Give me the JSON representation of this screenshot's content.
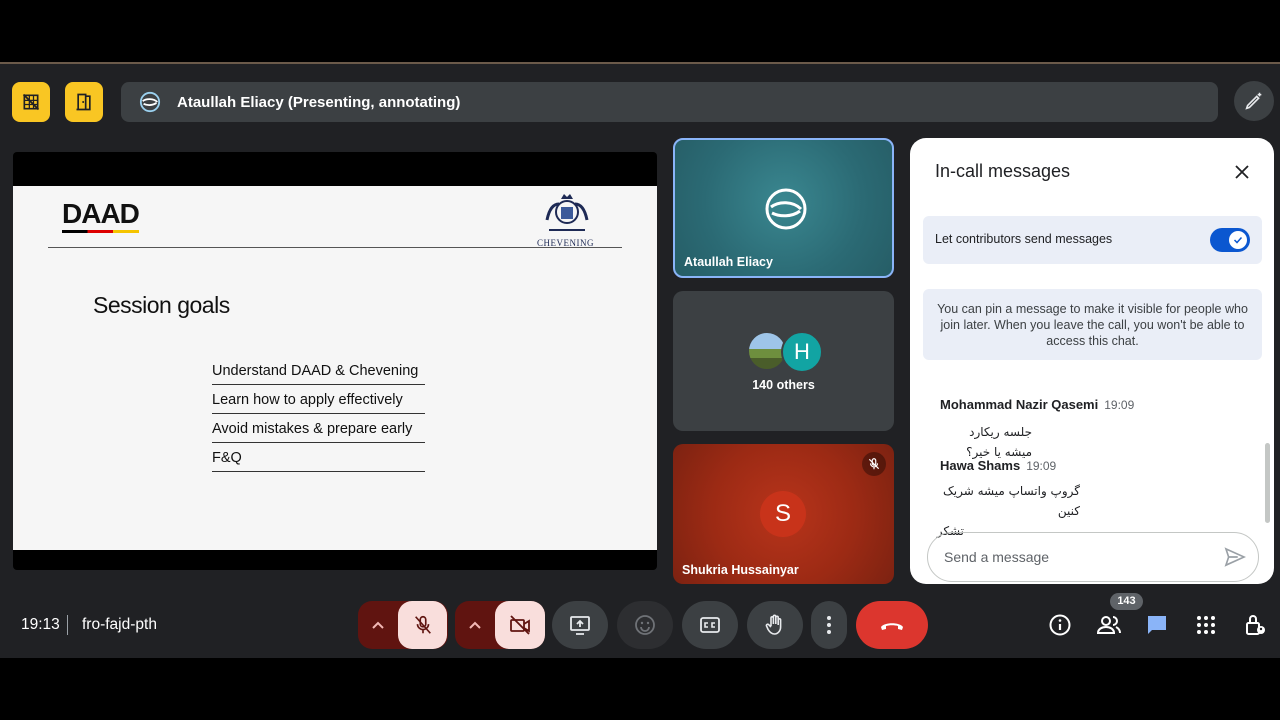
{
  "presenter": {
    "title": "Ataullah Eliacy (Presenting, annotating)"
  },
  "slide": {
    "logo_text": "DAAD",
    "partner_text": "CHEVENING",
    "title": "Session goals",
    "goals": [
      "Understand DAAD & Chevening",
      "Learn how to apply effectively",
      "Avoid mistakes & prepare early",
      "F&Q"
    ]
  },
  "tiles": {
    "presenter_name": "Ataullah Eliacy",
    "others_label": "140 others",
    "others_initial": "H",
    "speaker_name": "Shukria Hussainyar",
    "speaker_initial": "S"
  },
  "panel": {
    "title": "In-call messages",
    "toggle_label": "Let contributors send messages",
    "toggle_on": true,
    "pin_note": "You can pin a message to make it visible for people who join later. When you leave the call, you won't be able to access this chat.",
    "messages": [
      {
        "sender": "Mohammad Nazir Qasemi",
        "time": "19:09",
        "lines": [
          "جلسه ریکارد میشه یا خیر؟"
        ]
      },
      {
        "sender": "Hawa Shams",
        "time": "19:09",
        "lines": [
          "گروپ واتساپ میشه شریک کنین",
          "تشکر"
        ]
      }
    ],
    "input_placeholder": "Send a message"
  },
  "bottom": {
    "time": "19:13",
    "meeting_code": "fro-fajd-pth",
    "participants_count": "143"
  },
  "colors": {
    "accent": "#f9c623",
    "end_call": "#dc362e",
    "toggle": "#0b57d0",
    "chat_active": "#8ab4f8"
  }
}
